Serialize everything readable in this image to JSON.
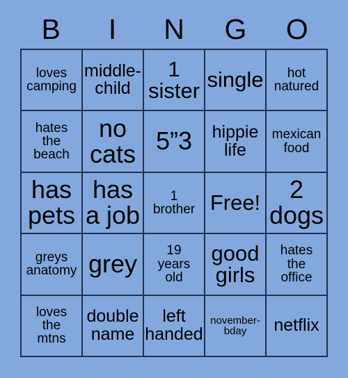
{
  "card": {
    "title": "BINGO",
    "background_color": "#83a8de",
    "border_color": "#20304e",
    "text_color": "#000000"
  },
  "header": {
    "letters": [
      "B",
      "I",
      "N",
      "G",
      "O"
    ]
  },
  "grid": {
    "columns": 5,
    "rows": 5,
    "cells": [
      {
        "text": "loves\ncamping",
        "size": "s-sm",
        "free": false
      },
      {
        "text": "middle-\nchild",
        "size": "s-md",
        "free": false
      },
      {
        "text": "1\nsister",
        "size": "s-lg",
        "free": false
      },
      {
        "text": "single",
        "size": "s-lg",
        "free": false
      },
      {
        "text": "hot\nnatured",
        "size": "s-sm",
        "free": false
      },
      {
        "text": "hates\nthe\nbeach",
        "size": "s-sm",
        "free": false
      },
      {
        "text": "no\ncats",
        "size": "s-xl",
        "free": false
      },
      {
        "text": "5”3",
        "size": "s-xl",
        "free": false
      },
      {
        "text": "hippie\nlife",
        "size": "s-md",
        "free": false
      },
      {
        "text": "mexican\nfood",
        "size": "s-sm",
        "free": false
      },
      {
        "text": "has\npets",
        "size": "s-xl",
        "free": false
      },
      {
        "text": "has\na job",
        "size": "s-xl",
        "free": false
      },
      {
        "text": "1\nbrother",
        "size": "s-sm",
        "free": false
      },
      {
        "text": "Free!",
        "size": "s-lg",
        "free": true
      },
      {
        "text": "2\ndogs",
        "size": "s-xl",
        "free": false
      },
      {
        "text": "greys\nanatomy",
        "size": "s-sm",
        "free": false
      },
      {
        "text": "grey",
        "size": "s-xl",
        "free": false
      },
      {
        "text": "19\nyears\nold",
        "size": "s-sm",
        "free": false
      },
      {
        "text": "good\ngirls",
        "size": "s-lg",
        "free": false
      },
      {
        "text": "hates\nthe\noffice",
        "size": "s-sm",
        "free": false
      },
      {
        "text": "loves\nthe\nmtns",
        "size": "s-sm",
        "free": false
      },
      {
        "text": "double\nname",
        "size": "s-md",
        "free": false
      },
      {
        "text": "left\nhanded",
        "size": "s-md",
        "free": false
      },
      {
        "text": "november-\nbday",
        "size": "s-xs",
        "free": false
      },
      {
        "text": "netflix",
        "size": "s-md",
        "free": false
      }
    ]
  }
}
